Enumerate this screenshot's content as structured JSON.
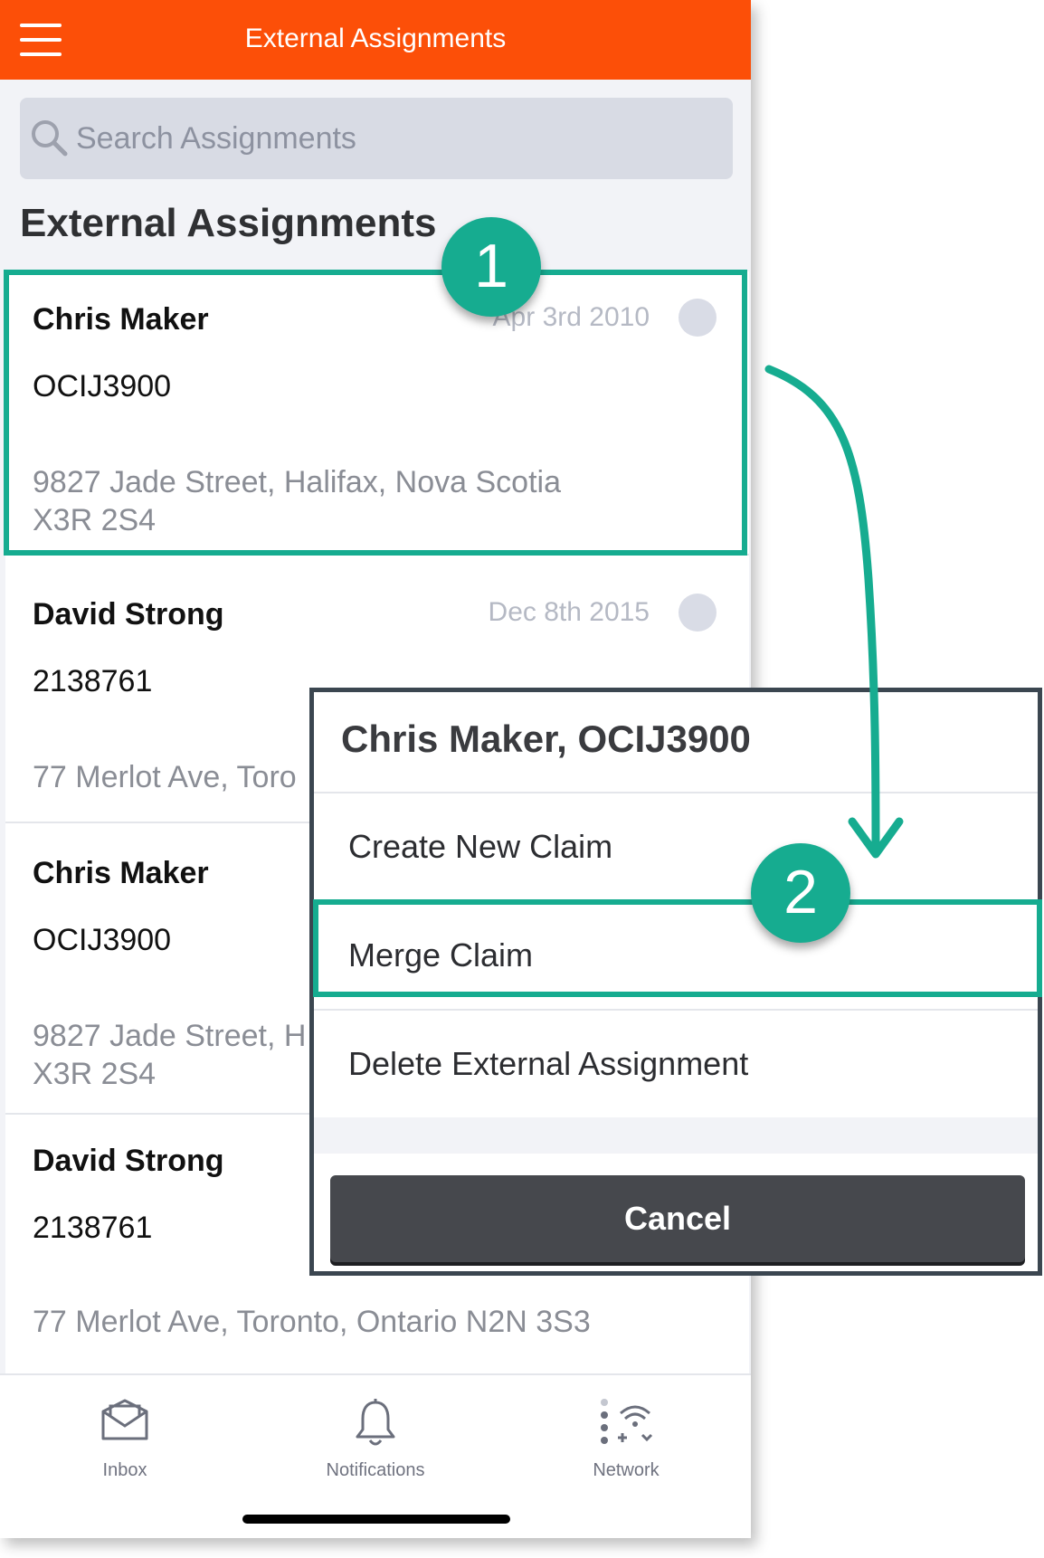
{
  "topbar": {
    "title": "External Assignments"
  },
  "search": {
    "placeholder": "Search Assignments"
  },
  "section": {
    "title": "External Assignments"
  },
  "assignments": [
    {
      "name": "Chris Maker",
      "code": "OCIJ3900",
      "date": "Apr 3rd 2010",
      "address_line1": "9827 Jade Street, Halifax, Nova Scotia",
      "address_line2": "X3R 2S4"
    },
    {
      "name": "David Strong",
      "code": "2138761",
      "date": "Dec 8th 2015",
      "address_line1": "77 Merlot Ave, Toro",
      "address_line2": ""
    },
    {
      "name": "Chris Maker",
      "code": "OCIJ3900",
      "date": "",
      "address_line1": "9827 Jade Street, H",
      "address_line2": "X3R 2S4"
    },
    {
      "name": "David Strong",
      "code": "2138761",
      "date": "",
      "address_line1": "77 Merlot Ave, Toronto, Ontario N2N 3S3",
      "address_line2": ""
    }
  ],
  "action_sheet": {
    "title": "Chris Maker, OCIJ3900",
    "options": [
      "Create New Claim",
      "Merge Claim",
      "Delete External Assignment"
    ],
    "cancel_label": "Cancel"
  },
  "callouts": {
    "step1": "1",
    "step2": "2"
  },
  "tabs": [
    {
      "label": "Inbox",
      "icon": "inbox-icon"
    },
    {
      "label": "Notifications",
      "icon": "bell-icon"
    },
    {
      "label": "Network",
      "icon": "network-icon"
    }
  ],
  "colors": {
    "header": "#fc4f08",
    "callout": "#16ac90",
    "cancel": "#46484d"
  }
}
